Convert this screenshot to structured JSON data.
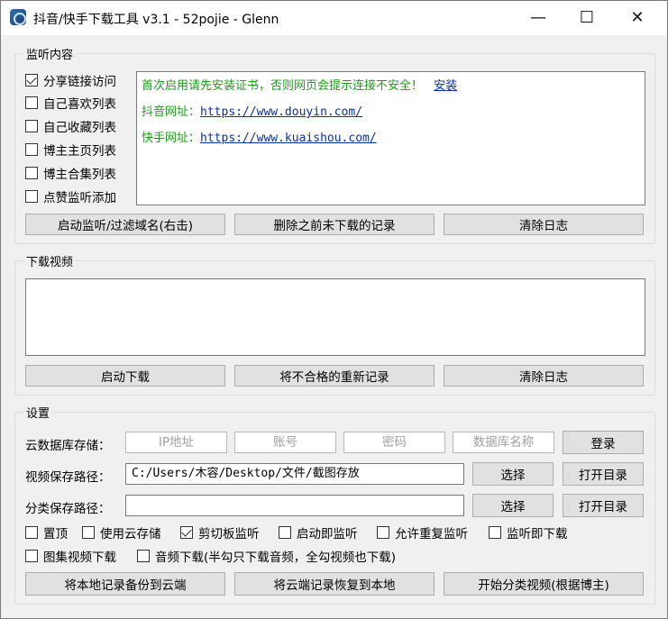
{
  "window": {
    "title": "抖音/快手下载工具 v3.1 - 52pojie - Glenn",
    "minimize": "—",
    "maximize": "☐",
    "close": "✕"
  },
  "monitor": {
    "legend": "监听内容",
    "checkboxes": [
      {
        "label": "分享链接访问",
        "checked": true
      },
      {
        "label": "自己喜欢列表",
        "checked": false
      },
      {
        "label": "自己收藏列表",
        "checked": false
      },
      {
        "label": "博主主页列表",
        "checked": false
      },
      {
        "label": "博主合集列表",
        "checked": false
      },
      {
        "label": "点赞监听添加",
        "checked": false
      }
    ],
    "log": {
      "notice": "首次启用请先安装证书，否则网页会提示连接不安全！",
      "install_link": "安装",
      "douyin_label": "抖音网址：",
      "douyin_url": "https://www.douyin.com/",
      "kuaishou_label": "快手网址：",
      "kuaishou_url": "https://www.kuaishou.com/"
    },
    "buttons": {
      "start": "启动监听/过滤域名(右击)",
      "delete": "删除之前未下载的记录",
      "clear": "清除日志"
    }
  },
  "download": {
    "legend": "下载视频",
    "buttons": {
      "start": "启动下载",
      "rerecord": "将不合格的重新记录",
      "clear": "清除日志"
    }
  },
  "settings": {
    "legend": "设置",
    "cloud_label": "云数据库存储：",
    "ip_placeholder": "IP地址",
    "account_placeholder": "账号",
    "password_placeholder": "密码",
    "dbname_placeholder": "数据库名称",
    "login": "登录",
    "video_path_label": "视频保存路径：",
    "video_path": "C:/Users/木容/Desktop/文件/截图存放",
    "category_path_label": "分类保存路径：",
    "category_path": "",
    "choose": "选择",
    "open_dir": "打开目录",
    "options_row1": [
      {
        "label": "置顶",
        "checked": false
      },
      {
        "label": "使用云存储",
        "checked": false
      },
      {
        "label": "剪切板监听",
        "checked": true
      },
      {
        "label": "启动即监听",
        "checked": false
      },
      {
        "label": "允许重复监听",
        "checked": false
      },
      {
        "label": "监听即下载",
        "checked": false
      }
    ],
    "options_row2": [
      {
        "label": "图集视频下载",
        "checked": false
      },
      {
        "label": "音频下载(半勾只下载音频，全勾视频也下载)",
        "checked": false
      }
    ],
    "buttons": {
      "backup": "将本地记录备份到云端",
      "restore": "将云端记录恢复到本地",
      "classify": "开始分类视频(根据博主)"
    }
  }
}
